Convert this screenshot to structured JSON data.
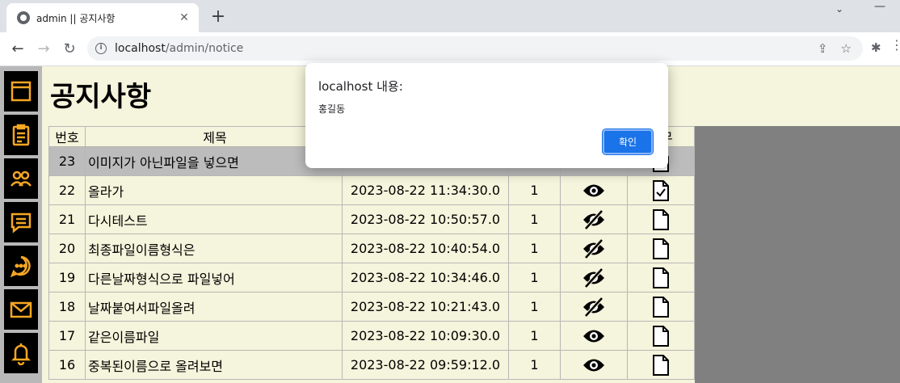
{
  "browser": {
    "tab_title": "admin || 공지사항",
    "tab_close": "✕",
    "new_tab": "+",
    "url_host": "localhost",
    "url_path": "/admin/notice"
  },
  "page": {
    "title": "공지사항"
  },
  "sidebar": {
    "icons": [
      "layout-icon",
      "clipboard-icon",
      "users-icon",
      "message-square-icon",
      "chat-bubble-icon",
      "mail-icon",
      "bell-icon"
    ]
  },
  "table": {
    "headers": [
      "번호",
      "제목",
      "",
      "",
      "",
      "유무"
    ],
    "rows": [
      {
        "num": "23",
        "title": "이미지가 아닌파일을 넣으면",
        "date": "",
        "views": "",
        "visible": "hidden-by-dialog",
        "file": "file",
        "selected": true
      },
      {
        "num": "22",
        "title": "올라가",
        "date": "2023-08-22 11:34:30.0",
        "views": "1",
        "visible": "eye",
        "file": "file-check",
        "selected": false
      },
      {
        "num": "21",
        "title": "다시테스트",
        "date": "2023-08-22 10:50:57.0",
        "views": "1",
        "visible": "eye-off",
        "file": "file",
        "selected": false
      },
      {
        "num": "20",
        "title": "최종파일이름형식은",
        "date": "2023-08-22 10:40:54.0",
        "views": "1",
        "visible": "eye-off",
        "file": "file",
        "selected": false
      },
      {
        "num": "19",
        "title": "다른날짜형식으로 파일넣어",
        "date": "2023-08-22 10:34:46.0",
        "views": "1",
        "visible": "eye-off",
        "file": "file",
        "selected": false
      },
      {
        "num": "18",
        "title": "날짜붙여서파일올려",
        "date": "2023-08-22 10:21:43.0",
        "views": "1",
        "visible": "eye-off",
        "file": "file",
        "selected": false
      },
      {
        "num": "17",
        "title": "같은이름파일",
        "date": "2023-08-22 10:09:30.0",
        "views": "1",
        "visible": "eye",
        "file": "file",
        "selected": false
      },
      {
        "num": "16",
        "title": "중복된이름으로 올려보면",
        "date": "2023-08-22 09:59:12.0",
        "views": "1",
        "visible": "eye",
        "file": "file",
        "selected": false
      }
    ]
  },
  "dialog": {
    "title": "localhost 내용:",
    "message": "홍길동",
    "ok_label": "확인"
  },
  "colors": {
    "page_bg": "#f5f4dc",
    "sidebar_icon": "#f5a623",
    "selected_row": "#bcbcbc",
    "dialog_button": "#1a73e8"
  }
}
